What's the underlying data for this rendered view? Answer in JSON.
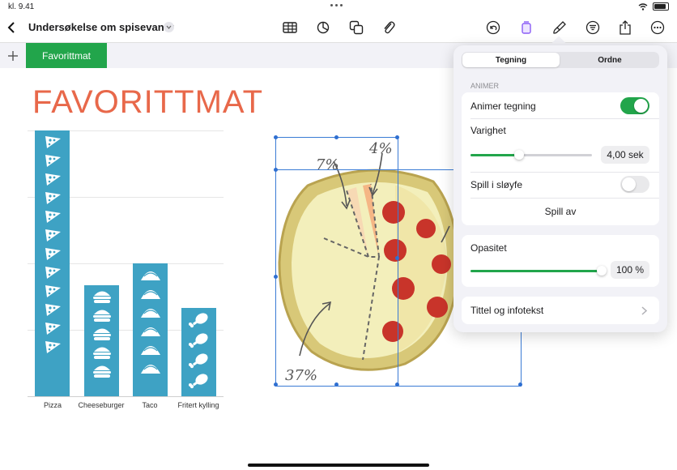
{
  "status_bar": {
    "time": "kl. 9.41"
  },
  "toolbar": {
    "document_title": "Undersøkelse om spisevaner",
    "icons": [
      "chevron-left-icon",
      "table-icon",
      "chart-icon",
      "shapes-icon",
      "paperclip-icon",
      "undo-icon",
      "format-icon",
      "paintbrush-icon",
      "filter-icon",
      "share-icon",
      "more-icon"
    ]
  },
  "sheets": {
    "tabs": [
      {
        "label": "Favorittmat"
      }
    ]
  },
  "canvas": {
    "title": "FAVORITTMAT",
    "chart_categories": [
      "Pizza",
      "Cheeseburger",
      "Taco",
      "Fritert kylling"
    ],
    "pizza_annotations": [
      "7%",
      "4%",
      "37%"
    ]
  },
  "popover": {
    "segments": [
      "Tegning",
      "Ordne"
    ],
    "section_header": "ANIMER",
    "animate_label": "Animer tegning",
    "animate_on": true,
    "duration_label": "Varighet",
    "duration_value": "4,00 sek",
    "duration_fraction": 0.4,
    "loop_label": "Spill i sløyfe",
    "loop_on": false,
    "play_label": "Spill av",
    "opacity_label": "Opasitet",
    "opacity_value": "100 %",
    "opacity_fraction": 1.0,
    "caption_label": "Tittel og infotekst"
  },
  "colors": {
    "accent_green": "#22a54b",
    "bar_blue": "#3ea2c4",
    "title_orange": "#e8684a",
    "selection_blue": "#2f6fd1"
  }
}
